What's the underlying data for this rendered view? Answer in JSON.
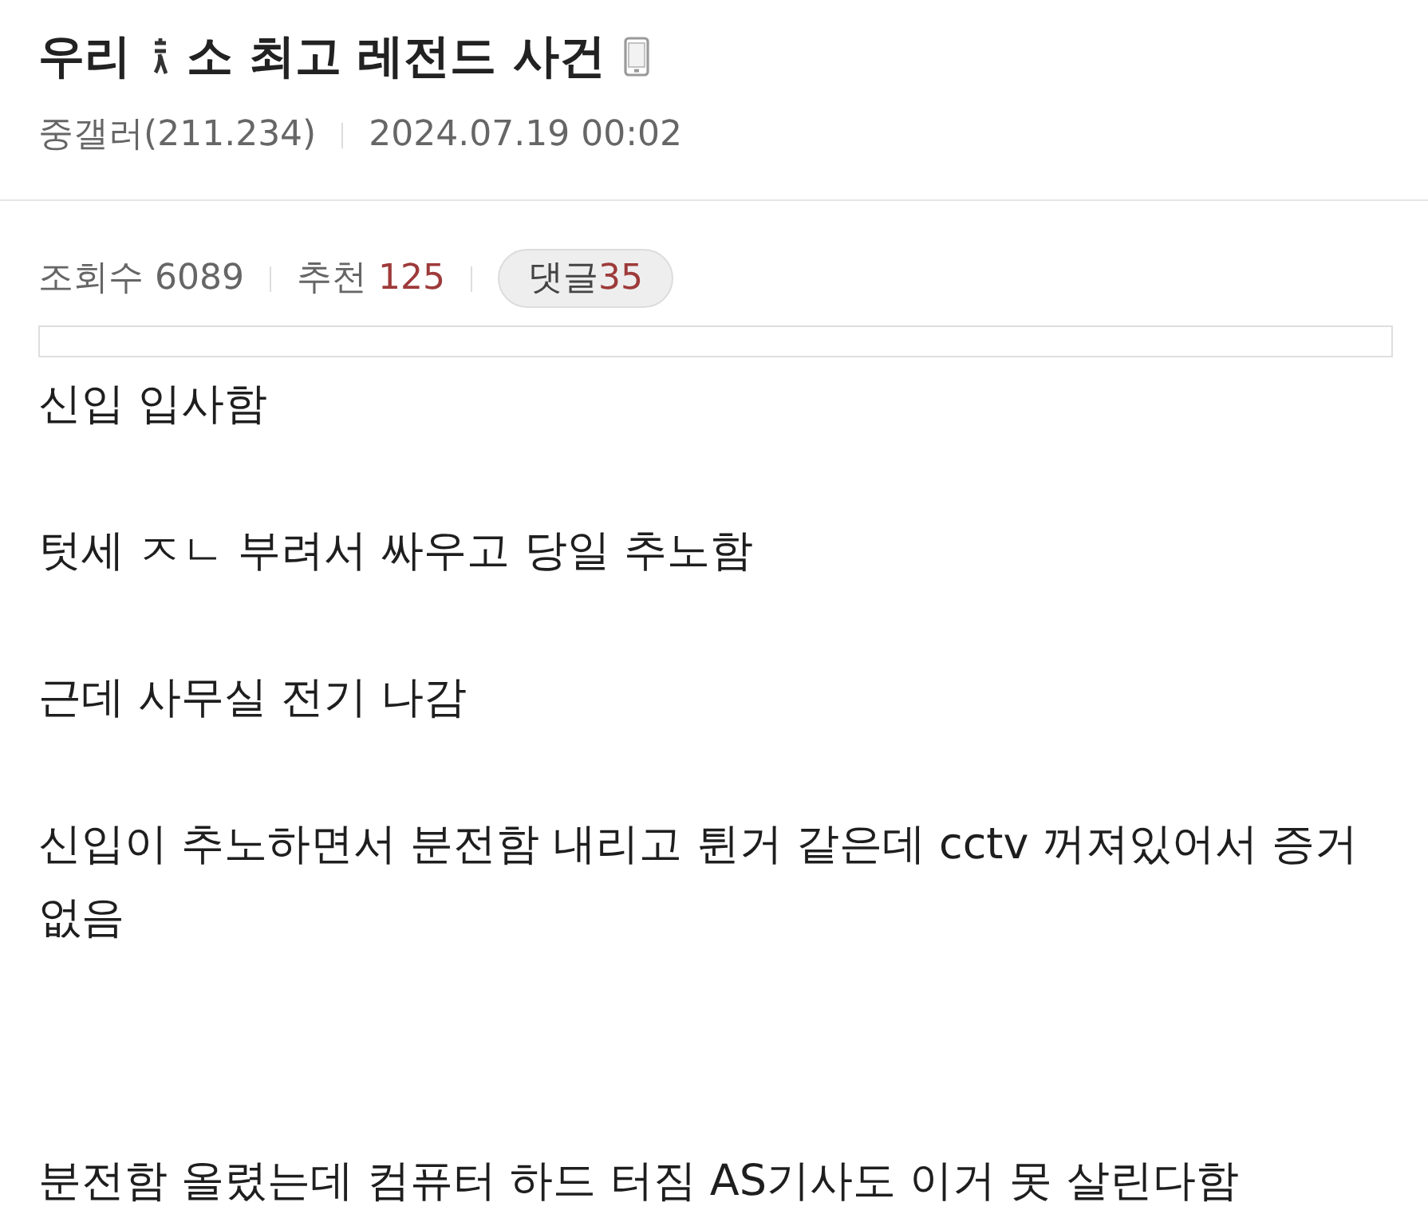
{
  "post": {
    "title_parts": [
      "우리",
      "소 최고 레전드 사건"
    ],
    "redacted": true,
    "mobile": true,
    "author": "중갤러(211.234)",
    "date": "2024.07.19 00:02"
  },
  "stats": {
    "views_label": "조회수",
    "views": "6089",
    "recommend_label": "추천",
    "recommend": "125",
    "comments_label": "댓글",
    "comments": "35"
  },
  "body": [
    {
      "text": "신입 입사함"
    },
    {
      "text": "텃세 ㅈㄴ 부려서 싸우고 당일 추노함"
    },
    {
      "text": "근데 사무실 전기 나감"
    },
    {
      "text": "신입이 추노하면서 분전함 내리고 튄거 같은데 cctv 꺼져있어서 증거 없음"
    },
    {
      "text": "분전함 올렸는데 컴퓨터 하드 터짐 AS기사도 이거 못 살린다함"
    }
  ]
}
